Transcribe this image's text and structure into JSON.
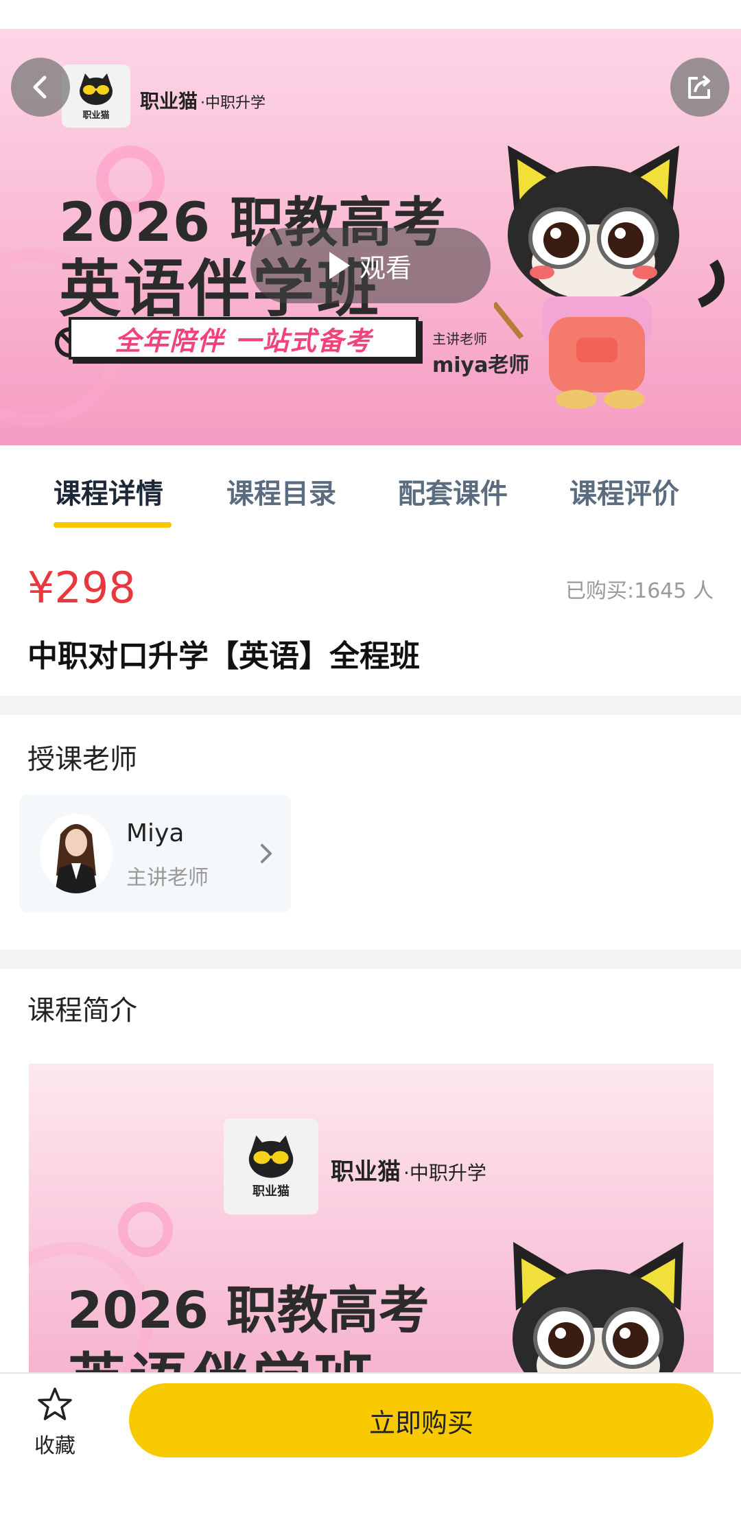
{
  "hero": {
    "brand_name": "职业猫",
    "brand_sub": "·中职升学",
    "brand_logo_text": "职业猫",
    "year_line": "2026 职教高考",
    "class_line": "英语伴学班",
    "slogan": "全年陪伴 一站式备考",
    "teacher_caption": "主讲老师",
    "teacher_name": "miya老师",
    "watch_label": "观看"
  },
  "tabs": [
    {
      "label": "课程详情",
      "active": true
    },
    {
      "label": "课程目录",
      "active": false
    },
    {
      "label": "配套课件",
      "active": false
    },
    {
      "label": "课程评价",
      "active": false
    }
  ],
  "course": {
    "price": "¥298",
    "bought": "已购买:1645 人",
    "title": "中职对口升学【英语】全程班"
  },
  "teacher_section": {
    "heading": "授课老师",
    "name": "Miya",
    "role": "主讲老师"
  },
  "intro_section": {
    "heading": "课程简介",
    "brand_name": "职业猫",
    "brand_sub": "·中职升学",
    "brand_logo_text": "职业猫",
    "year_line": "2026 职教高考",
    "class_line": "英语伴学班"
  },
  "bottom_bar": {
    "favorite_label": "收藏",
    "buy_label": "立即购买"
  },
  "colors": {
    "accent_yellow": "#f9c900",
    "price_red": "#e8383e",
    "hero_pink": "#f9b8d2"
  },
  "icons": [
    "back-icon",
    "share-icon",
    "play-icon",
    "chevron-right-icon",
    "star-icon",
    "no-entry-icon"
  ]
}
